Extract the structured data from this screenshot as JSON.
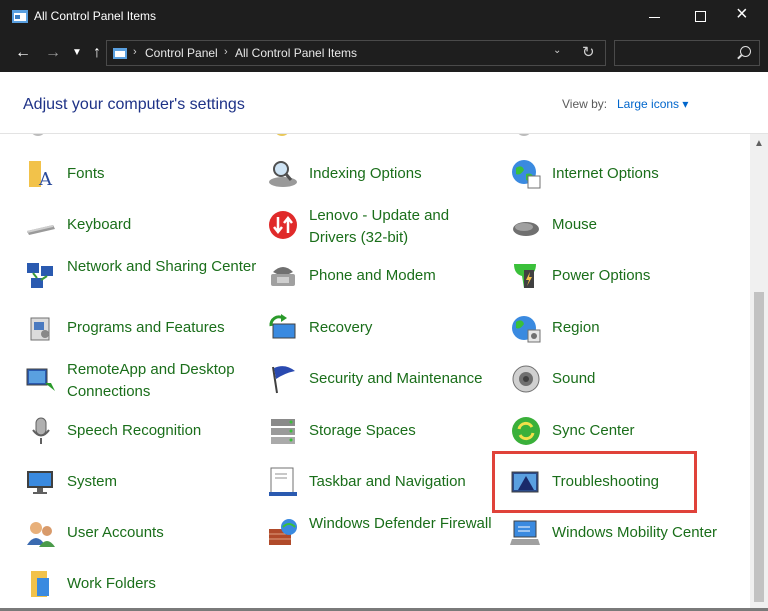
{
  "window": {
    "title": "All Control Panel Items"
  },
  "address": {
    "crumbs": [
      "Control Panel",
      "All Control Panel Items"
    ],
    "search_placeholder": ""
  },
  "header": {
    "title": "Adjust your computer's settings",
    "view_by_label": "View by:",
    "view_by_value": "Large icons ▾"
  },
  "items": [
    {
      "label": "Fonts",
      "icon": "fonts-icon"
    },
    {
      "label": "Indexing Options",
      "icon": "indexing-options-icon"
    },
    {
      "label": "Internet Options",
      "icon": "internet-options-icon"
    },
    {
      "label": "Keyboard",
      "icon": "keyboard-icon"
    },
    {
      "label": "Lenovo - Update and Drivers (32-bit)",
      "icon": "lenovo-update-icon"
    },
    {
      "label": "Mouse",
      "icon": "mouse-icon"
    },
    {
      "label": "Network and Sharing Center",
      "icon": "network-icon"
    },
    {
      "label": "Phone and Modem",
      "icon": "phone-modem-icon"
    },
    {
      "label": "Power Options",
      "icon": "power-options-icon"
    },
    {
      "label": "Programs and Features",
      "icon": "programs-features-icon"
    },
    {
      "label": "Recovery",
      "icon": "recovery-icon"
    },
    {
      "label": "Region",
      "icon": "region-icon"
    },
    {
      "label": "RemoteApp and Desktop Connections",
      "icon": "remoteapp-icon"
    },
    {
      "label": "Security and Maintenance",
      "icon": "security-flag-icon"
    },
    {
      "label": "Sound",
      "icon": "sound-icon"
    },
    {
      "label": "Speech Recognition",
      "icon": "microphone-icon"
    },
    {
      "label": "Storage Spaces",
      "icon": "storage-spaces-icon"
    },
    {
      "label": "Sync Center",
      "icon": "sync-center-icon"
    },
    {
      "label": "System",
      "icon": "system-monitor-icon"
    },
    {
      "label": "Taskbar and Navigation",
      "icon": "taskbar-icon"
    },
    {
      "label": "Troubleshooting",
      "icon": "troubleshooting-icon"
    },
    {
      "label": "User Accounts",
      "icon": "user-accounts-icon"
    },
    {
      "label": "Windows Defender Firewall",
      "icon": "firewall-icon"
    },
    {
      "label": "Windows Mobility Center",
      "icon": "mobility-center-icon"
    },
    {
      "label": "Work Folders",
      "icon": "work-folders-icon"
    }
  ],
  "colors": {
    "link": "#1a6e1a",
    "title": "#1e3287",
    "highlight": "#e0423a"
  }
}
